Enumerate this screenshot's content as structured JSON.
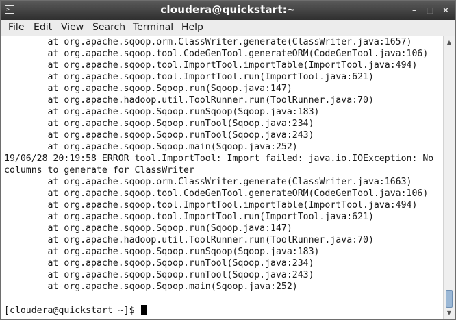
{
  "window": {
    "title": "cloudera@quickstart:~",
    "controls": {
      "minimize": "–",
      "maximize": "□",
      "close": "✕"
    }
  },
  "menu": {
    "items": [
      "File",
      "Edit",
      "View",
      "Search",
      "Terminal",
      "Help"
    ]
  },
  "terminal": {
    "lines": [
      "        at org.apache.sqoop.orm.ClassWriter.generate(ClassWriter.java:1657)",
      "        at org.apache.sqoop.tool.CodeGenTool.generateORM(CodeGenTool.java:106)",
      "        at org.apache.sqoop.tool.ImportTool.importTable(ImportTool.java:494)",
      "        at org.apache.sqoop.tool.ImportTool.run(ImportTool.java:621)",
      "        at org.apache.sqoop.Sqoop.run(Sqoop.java:147)",
      "        at org.apache.hadoop.util.ToolRunner.run(ToolRunner.java:70)",
      "        at org.apache.sqoop.Sqoop.runSqoop(Sqoop.java:183)",
      "        at org.apache.sqoop.Sqoop.runTool(Sqoop.java:234)",
      "        at org.apache.sqoop.Sqoop.runTool(Sqoop.java:243)",
      "        at org.apache.sqoop.Sqoop.main(Sqoop.java:252)",
      "19/06/28 20:19:58 ERROR tool.ImportTool: Import failed: java.io.IOException: No",
      "columns to generate for ClassWriter",
      "        at org.apache.sqoop.orm.ClassWriter.generate(ClassWriter.java:1663)",
      "        at org.apache.sqoop.tool.CodeGenTool.generateORM(CodeGenTool.java:106)",
      "        at org.apache.sqoop.tool.ImportTool.importTable(ImportTool.java:494)",
      "        at org.apache.sqoop.tool.ImportTool.run(ImportTool.java:621)",
      "        at org.apache.sqoop.Sqoop.run(Sqoop.java:147)",
      "        at org.apache.hadoop.util.ToolRunner.run(ToolRunner.java:70)",
      "        at org.apache.sqoop.Sqoop.runSqoop(Sqoop.java:183)",
      "        at org.apache.sqoop.Sqoop.runTool(Sqoop.java:234)",
      "        at org.apache.sqoop.Sqoop.runTool(Sqoop.java:243)",
      "        at org.apache.sqoop.Sqoop.main(Sqoop.java:252)",
      "",
      "[cloudera@quickstart ~]$ "
    ]
  }
}
